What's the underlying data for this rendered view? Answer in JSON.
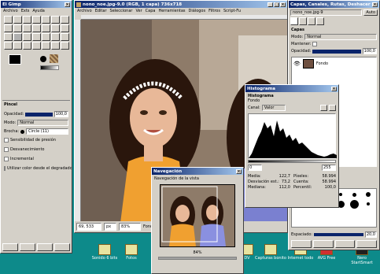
{
  "toolbox": {
    "title": "El Gimp",
    "menu": [
      "Archivo",
      "Exts",
      "Ayuda"
    ],
    "brush_title": "Pincel",
    "opacity_label": "Opacidad:",
    "opacity_value": "100,0",
    "mode_label": "Modo:",
    "mode_value": "Normal",
    "brush_label": "Brocha:",
    "brush_value": "Circle (11)",
    "checkboxes": [
      "Sensibilidad de presión",
      "Desvanecimiento",
      "Incremental",
      "Utilizar color desde el degradado"
    ]
  },
  "image_window": {
    "title": "nono_noe.jpg-9.0 (RGB, 1 capa) 736x718",
    "menu": [
      "Archivo",
      "Editar",
      "Seleccionar",
      "Ver",
      "Capa",
      "Herramientas",
      "Diálogos",
      "Filtros",
      "Script-Fu"
    ],
    "coords": "69, 533",
    "unit": "px",
    "zoom": "83%",
    "status": "Fondo (26,2 MB)"
  },
  "layers_dialog": {
    "title": "Capas, Canales, Rutas, Deshacer",
    "image_name": "nono_noe.jpg-9",
    "auto_label": "Auto",
    "section": "Capas",
    "mode_label": "Modo:",
    "mode_value": "Normal",
    "keep_label": "Mantener:",
    "opacity_label": "Opacidad:",
    "opacity_value": "100,0",
    "layer_name": "Fondo"
  },
  "histogram": {
    "title": "Histograma",
    "subtitle": "Histograma",
    "image_label": "Fondo",
    "channel_label": "Canal:",
    "channel_value": "Valor",
    "range_min": "0",
    "range_max": "255",
    "stats_left": [
      {
        "label": "Media:",
        "value": "122,7"
      },
      {
        "label": "Desviación est.:",
        "value": "73,2"
      },
      {
        "label": "Mediana:",
        "value": "112,0"
      }
    ],
    "stats_right": [
      {
        "label": "Píxeles:",
        "value": "58.994"
      },
      {
        "label": "Cuenta:",
        "value": "58.994"
      },
      {
        "label": "Percentil:",
        "value": "100,0"
      }
    ]
  },
  "navigation": {
    "title": "Navegación",
    "subtitle": "Navegación de la vista",
    "zoom": "84%"
  },
  "brushes": {
    "spacing_label": "Espaciado:",
    "spacing_value": "20,0"
  },
  "desktop_icons": [
    "Sonido 6 bits",
    "Fotos",
    "DV",
    "Capturas bonito",
    "Internet todo",
    "AVG Free",
    "Nero StartSmart"
  ],
  "colors": {
    "desktop": "#0d8a8a",
    "titlebar": "#0a246a",
    "face": "#d4d0c8"
  }
}
